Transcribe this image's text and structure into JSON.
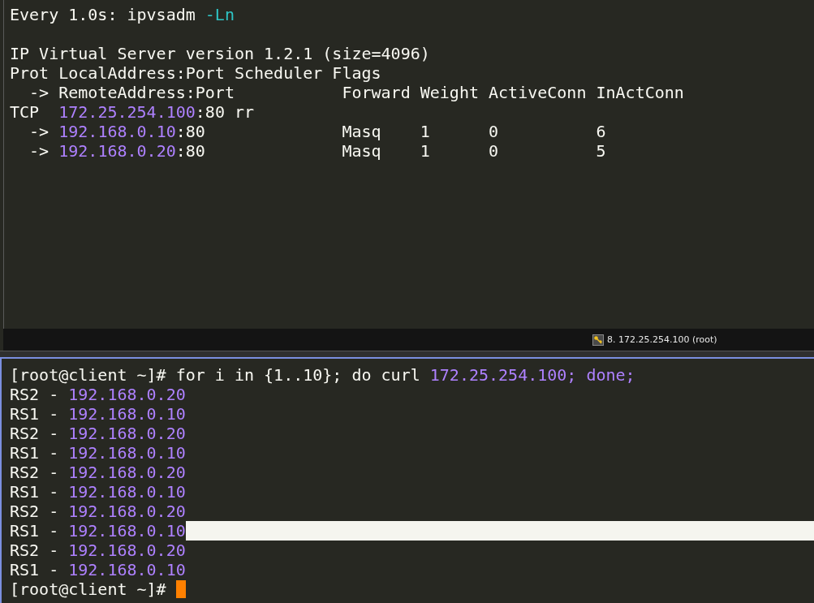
{
  "top_pane": {
    "lines": [
      {
        "kind": "text",
        "segments": [
          {
            "text": "Every 1.0s: ipvsadm ",
            "kind": "plain"
          },
          {
            "text": "-Ln",
            "kind": "flag"
          }
        ]
      },
      {
        "kind": "blank"
      },
      {
        "kind": "text",
        "segments": [
          {
            "text": "IP Virtual Server version 1.2.1 (size=4096)",
            "kind": "plain"
          }
        ]
      },
      {
        "kind": "text",
        "segments": [
          {
            "text": "Prot LocalAddress:Port Scheduler Flags",
            "kind": "plain"
          }
        ]
      },
      {
        "kind": "text",
        "segments": [
          {
            "text": "  -> RemoteAddress:Port           Forward Weight ActiveConn InActConn",
            "kind": "plain"
          }
        ]
      },
      {
        "kind": "text",
        "segments": [
          {
            "text": "TCP  ",
            "kind": "plain"
          },
          {
            "text": "172.25.254.100",
            "kind": "ip"
          },
          {
            "text": ":80 rr",
            "kind": "plain"
          }
        ]
      },
      {
        "kind": "text",
        "segments": [
          {
            "text": "  -> ",
            "kind": "plain"
          },
          {
            "text": "192.168.0.10",
            "kind": "ip"
          },
          {
            "text": ":80              Masq    1      0          6",
            "kind": "plain"
          }
        ]
      },
      {
        "kind": "text",
        "segments": [
          {
            "text": "  -> ",
            "kind": "plain"
          },
          {
            "text": "192.168.0.20",
            "kind": "ip"
          },
          {
            "text": ":80              Masq    1      0          5",
            "kind": "plain"
          }
        ]
      }
    ]
  },
  "status_bar": {
    "session": "8. 172.25.254.100 (root)"
  },
  "bottom_pane": {
    "lines": [
      {
        "segments": [
          {
            "text": "[root@client ~]# for i in {1..10}; do curl ",
            "kind": "plain"
          },
          {
            "text": "172.25.254.100; done;",
            "kind": "ip"
          }
        ],
        "highlighted": false
      },
      {
        "segments": [
          {
            "text": "RS2 - ",
            "kind": "plain"
          },
          {
            "text": "192.168.0.20",
            "kind": "ip"
          }
        ],
        "highlighted": false
      },
      {
        "segments": [
          {
            "text": "RS1 - ",
            "kind": "plain"
          },
          {
            "text": "192.168.0.10",
            "kind": "ip"
          }
        ],
        "highlighted": false
      },
      {
        "segments": [
          {
            "text": "RS2 - ",
            "kind": "plain"
          },
          {
            "text": "192.168.0.20",
            "kind": "ip"
          }
        ],
        "highlighted": false
      },
      {
        "segments": [
          {
            "text": "RS1 - ",
            "kind": "plain"
          },
          {
            "text": "192.168.0.10",
            "kind": "ip"
          }
        ],
        "highlighted": false
      },
      {
        "segments": [
          {
            "text": "RS2 - ",
            "kind": "plain"
          },
          {
            "text": "192.168.0.20",
            "kind": "ip"
          }
        ],
        "highlighted": false
      },
      {
        "segments": [
          {
            "text": "RS1 - ",
            "kind": "plain"
          },
          {
            "text": "192.168.0.10",
            "kind": "ip"
          }
        ],
        "highlighted": false
      },
      {
        "segments": [
          {
            "text": "RS2 - ",
            "kind": "plain"
          },
          {
            "text": "192.168.0.20",
            "kind": "ip"
          }
        ],
        "highlighted": false
      },
      {
        "segments": [
          {
            "text": "RS1 - ",
            "kind": "plain"
          },
          {
            "text": "192.168.0.10",
            "kind": "ip"
          }
        ],
        "highlighted": true
      },
      {
        "segments": [
          {
            "text": "RS2 - ",
            "kind": "plain"
          },
          {
            "text": "192.168.0.20",
            "kind": "ip"
          }
        ],
        "highlighted": false
      },
      {
        "segments": [
          {
            "text": "RS1 - ",
            "kind": "plain"
          },
          {
            "text": "192.168.0.10",
            "kind": "ip"
          }
        ],
        "highlighted": false
      }
    ],
    "prompt": "[root@client ~]# "
  }
}
